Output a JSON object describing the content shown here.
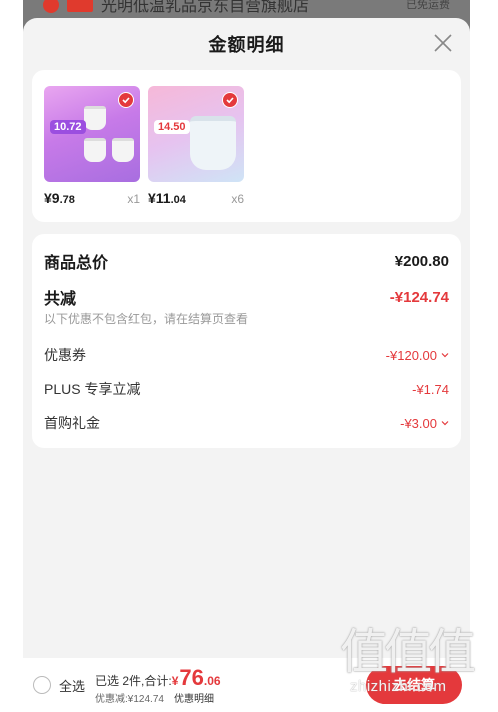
{
  "backdrop": {
    "store_name": "光明低温乳品京东自营旗舰店",
    "shipping": "已免运费"
  },
  "sheet": {
    "title": "金额明细"
  },
  "products": [
    {
      "badge": "10.72",
      "price_int": "¥9",
      "price_dec": ".78",
      "qty": "x1"
    },
    {
      "badge": "14.50",
      "price_int": "¥11",
      "price_dec": ".04",
      "qty": "x6"
    }
  ],
  "summary": {
    "total_label": "商品总价",
    "total_value": "¥200.80",
    "reduce_label": "共减",
    "reduce_value": "-¥124.74",
    "note": "以下优惠不包含红包，请在结算页查看",
    "items": [
      {
        "label": "优惠券",
        "value": "-¥120.00"
      },
      {
        "label": "PLUS 专享立减",
        "value": "-¥1.74"
      },
      {
        "label": "首购礼金",
        "value": "-¥3.00"
      }
    ]
  },
  "bottom": {
    "select_all": "全选",
    "selected_text": "已选 2件,合计:",
    "yen": "¥",
    "total_int": "76",
    "total_dec": ".06",
    "discount_text": "优惠减:¥124.74",
    "detail_link": "优惠明细",
    "checkout": "去结算"
  },
  "watermark": {
    "glyphs": "值值值",
    "url": "zhizhizhi.com"
  },
  "colors": {
    "accent": "#e4393c",
    "sheet_bg": "#f3f3f3",
    "backdrop": "#7a7a7a"
  }
}
